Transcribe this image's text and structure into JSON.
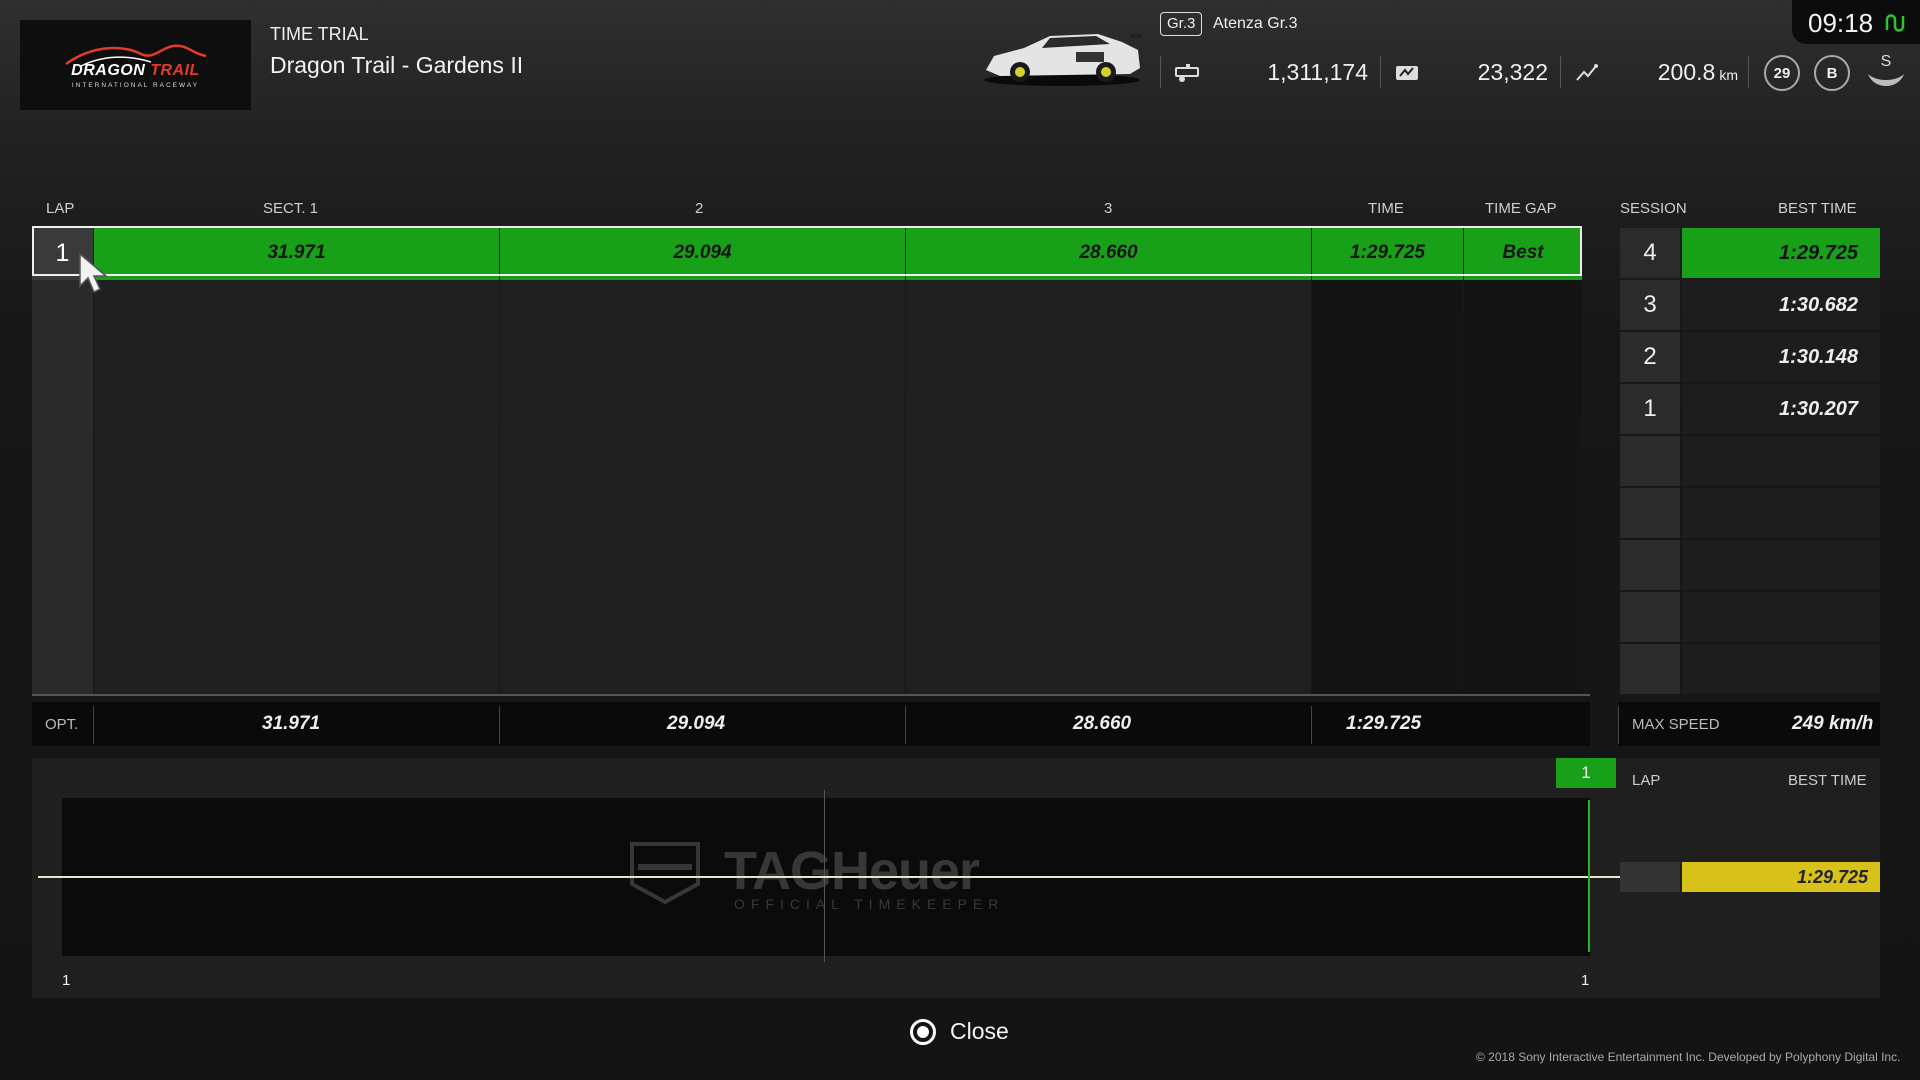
{
  "header": {
    "logo_text_main_1": "DRAGON",
    "logo_text_main_2": "TRAIL",
    "logo_text_sub": "INTERNATIONAL RACEWAY",
    "mode": "TIME TRIAL",
    "track": "Dragon Trail - Gardens II",
    "car_class": "Gr.3",
    "car_name": "Atenza Gr.3",
    "credits": "1,311,174",
    "mileage_points": "23,322",
    "distance": "200.8",
    "distance_unit": "km",
    "level": "29",
    "license": "B",
    "sport_rating": "S",
    "clock": "09:18",
    "icons": [
      "garage-icon",
      "mileage-icon",
      "distance-icon",
      "level-icon",
      "license-icon",
      "sport-icon",
      "signal-icon"
    ]
  },
  "table": {
    "headers": {
      "lap": "LAP",
      "sect1": "SECT. 1",
      "sect2": "2",
      "sect3": "3",
      "time": "TIME",
      "gap": "TIME GAP"
    },
    "laps": [
      {
        "lap": "1",
        "sect1": "31.971",
        "sect2": "29.094",
        "sect3": "28.660",
        "time": "1:29.725",
        "gap": "Best"
      }
    ],
    "total_rows": 9,
    "opt": {
      "label": "OPT.",
      "sect1": "31.971",
      "sect2": "29.094",
      "sect3": "28.660",
      "time": "1:29.725"
    }
  },
  "session": {
    "headers": {
      "session": "SESSION",
      "best": "BEST TIME"
    },
    "rows": [
      {
        "session": "4",
        "best": "1:29.725",
        "highlight": true
      },
      {
        "session": "3",
        "best": "1:30.682",
        "highlight": false
      },
      {
        "session": "2",
        "best": "1:30.148",
        "highlight": false
      },
      {
        "session": "1",
        "best": "1:30.207",
        "highlight": false
      }
    ],
    "total_rows": 9,
    "max_speed_label": "MAX SPEED",
    "max_speed": "249 km/h"
  },
  "graph": {
    "lap_marker": "1",
    "x_start": "1",
    "x_end": "1",
    "legend_lap": "LAP",
    "legend_best": "BEST TIME",
    "legend_value": "1:29.725",
    "watermark_brand": "TAGHeuer",
    "watermark_sub": "OFFICIAL TIMEKEEPER",
    "colors": {
      "line": "#e9e6c2",
      "marker": "#28b028",
      "legend": "#d8c21a"
    }
  },
  "footer": {
    "close": "Close",
    "copyright": "© 2018 Sony Interactive Entertainment Inc. Developed by Polyphony Digital Inc."
  },
  "colors": {
    "best_green": "#18a018",
    "background": "#141414"
  }
}
